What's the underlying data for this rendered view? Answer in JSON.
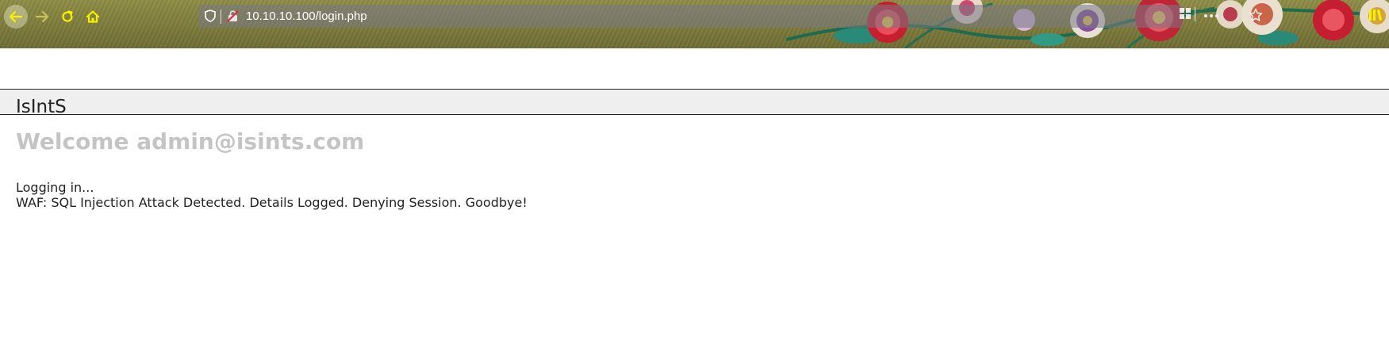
{
  "browser": {
    "url": "10.10.10.100/login.php",
    "icons": {
      "back": "back-arrow-icon",
      "forward": "forward-arrow-icon",
      "reload": "reload-icon",
      "home": "home-icon",
      "tracking": "shield-icon",
      "connection": "insecure-lock-icon",
      "permissions": "grid-icon",
      "page_actions": "more-icon",
      "bookmark": "star-icon",
      "library": "library-icon"
    },
    "colors": {
      "icon_yellow": "#f6f200",
      "theme_olive": "#7f7d3c"
    }
  },
  "page": {
    "brand": "IsIntS",
    "welcome": "Welcome admin@isints.com",
    "messages": [
      "Logging in...",
      "WAF: SQL Injection Attack Detected. Details Logged. Denying Session. Goodbye!"
    ]
  }
}
